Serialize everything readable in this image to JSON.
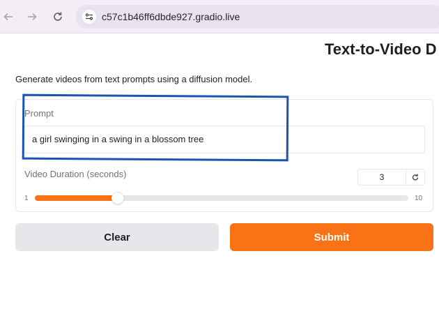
{
  "browser": {
    "url": "c57c1b46ff6dbde927.gradio.live",
    "back_icon": "arrow-left-icon",
    "forward_icon": "arrow-right-icon",
    "reload_icon": "reload-icon",
    "site_info_icon": "site-settings-icon"
  },
  "page": {
    "title": "Text-to-Video D",
    "description": "Generate videos from text prompts using a diffusion model."
  },
  "prompt": {
    "label": "Prompt",
    "value": "a girl swinging in a swing in a blossom tree"
  },
  "duration": {
    "label": "Video Duration (seconds)",
    "value": "3",
    "min": "1",
    "max": "10",
    "reset_icon": "reset-icon"
  },
  "buttons": {
    "clear": "Clear",
    "submit": "Submit"
  },
  "colors": {
    "accent": "#f97316",
    "annotation": "#1b55b1"
  }
}
